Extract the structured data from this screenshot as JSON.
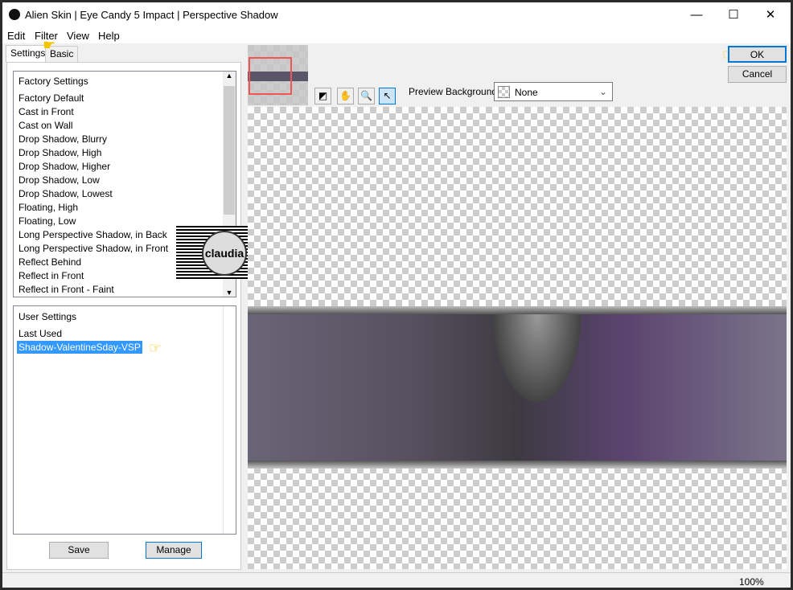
{
  "window": {
    "title": "Alien Skin | Eye Candy 5 Impact | Perspective Shadow",
    "minimize": "—",
    "maximize": "☐",
    "close": "✕"
  },
  "menu": [
    "Edit",
    "Filter",
    "View",
    "Help"
  ],
  "tabs": [
    "Settings",
    "Basic"
  ],
  "factory": {
    "header": "Factory Settings",
    "items": [
      "Factory Default",
      "Cast in Front",
      "Cast on Wall",
      "Drop Shadow, Blurry",
      "Drop Shadow, High",
      "Drop Shadow, Higher",
      "Drop Shadow, Low",
      "Drop Shadow, Lowest",
      "Floating, High",
      "Floating, Low",
      "Long Perspective Shadow, in Back",
      "Long Perspective Shadow, in Front",
      "Reflect Behind",
      "Reflect in Front",
      "Reflect in Front - Faint"
    ]
  },
  "user": {
    "header": "User Settings",
    "items": [
      "Last Used",
      "Shadow-ValentineSday-VSP"
    ],
    "selected": "Shadow-ValentineSday-VSP"
  },
  "buttons": {
    "save": "Save",
    "manage": "Manage",
    "ok": "OK",
    "cancel": "Cancel"
  },
  "preview": {
    "label": "Preview Background:",
    "value": "None"
  },
  "watermark": "claudia",
  "status": {
    "zoom": "100%"
  },
  "colors": {
    "accent": "#0078d7",
    "selection": "#3399ff"
  }
}
